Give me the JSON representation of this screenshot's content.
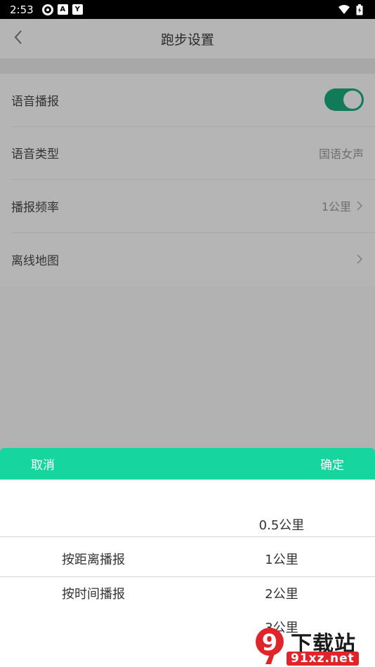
{
  "status_bar": {
    "time": "2:53",
    "icons": [
      "settings-icon",
      "a-box-icon",
      "y-box-icon"
    ],
    "a_label": "A",
    "y_label": "Y"
  },
  "header": {
    "title": "跑步设置"
  },
  "settings": {
    "items": [
      {
        "label": "语音播报",
        "type": "toggle",
        "value": true
      },
      {
        "label": "语音类型",
        "value": "国语女声"
      },
      {
        "label": "播报频率",
        "value": "1公里"
      },
      {
        "label": "离线地图",
        "value": ""
      }
    ]
  },
  "sheet": {
    "cancel_label": "取消",
    "confirm_label": "确定",
    "left_options": [
      "按距离播报",
      "按时间播报"
    ],
    "right_options": [
      "0.5公里",
      "1公里",
      "2公里",
      "3公里"
    ]
  },
  "watermark": {
    "main": "下载站",
    "sub": "91xz.net",
    "logo": "9"
  },
  "colors": {
    "accent": "#16d59e",
    "toggle_on": "#117a59"
  }
}
